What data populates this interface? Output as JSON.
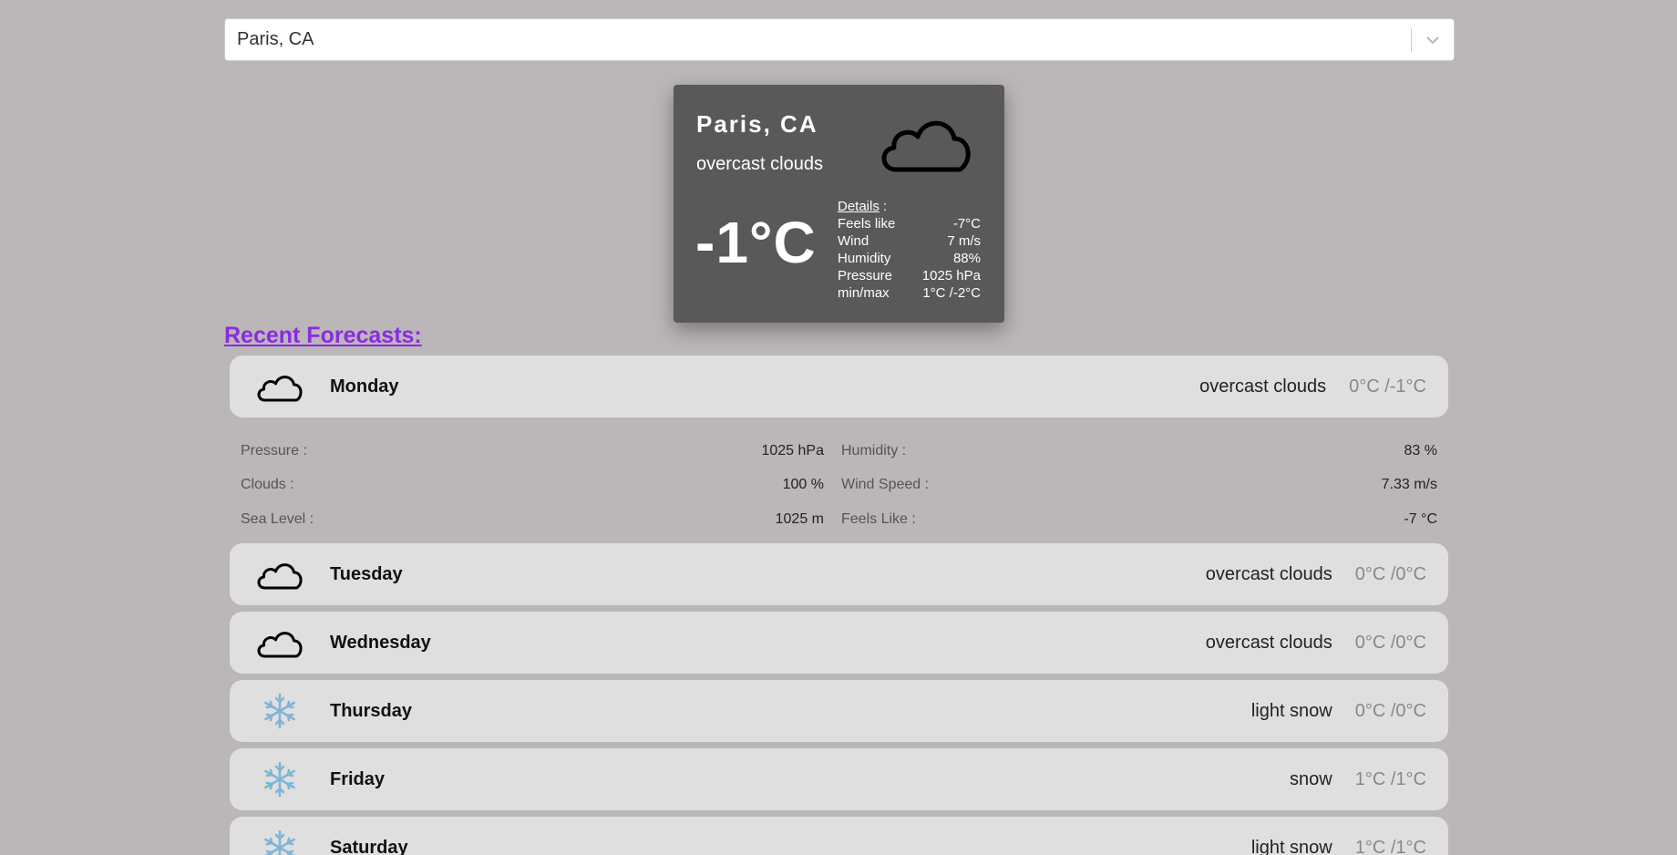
{
  "search": {
    "value": "Paris, CA"
  },
  "current": {
    "city": "Paris, CA",
    "description": "overcast clouds",
    "temperature": "-1°C",
    "icon": "cloud-icon",
    "details": {
      "title": "Details",
      "suffix": " :",
      "rows": [
        {
          "label": "Feels like",
          "value": "-7°C"
        },
        {
          "label": "Wind",
          "value": "7 m/s"
        },
        {
          "label": "Humidity",
          "value": "88%"
        },
        {
          "label": "Pressure",
          "value": "1025 hPa"
        },
        {
          "label": "min/max",
          "value": "1°C /-2°C"
        }
      ]
    }
  },
  "recent_title": "Recent Forecasts:",
  "forecast": [
    {
      "day": "Monday",
      "description": "overcast clouds",
      "temp": "0°C /-1°C",
      "icon": "cloud-icon"
    },
    {
      "day": "Tuesday",
      "description": "overcast clouds",
      "temp": "0°C /0°C",
      "icon": "cloud-icon"
    },
    {
      "day": "Wednesday",
      "description": "overcast clouds",
      "temp": "0°C /0°C",
      "icon": "cloud-icon"
    },
    {
      "day": "Thursday",
      "description": "light snow",
      "temp": "0°C /0°C",
      "icon": "snowflake-icon"
    },
    {
      "day": "Friday",
      "description": "snow",
      "temp": "1°C /1°C",
      "icon": "snowflake-icon"
    },
    {
      "day": "Saturday",
      "description": "light snow",
      "temp": "1°C /1°C",
      "icon": "snowflake-icon"
    }
  ],
  "monday_details": {
    "left": [
      {
        "label": "Pressure :",
        "value": "1025 hPa"
      },
      {
        "label": "Clouds :",
        "value": "100 %"
      },
      {
        "label": "Sea Level :",
        "value": "1025 m"
      }
    ],
    "right": [
      {
        "label": "Humidity :",
        "value": "83 %"
      },
      {
        "label": "Wind Speed :",
        "value": "7.33 m/s"
      },
      {
        "label": "Feels Like :",
        "value": "-7 °C"
      }
    ]
  },
  "colors": {
    "background": "#bbb6b7",
    "card": "#595959",
    "row": "#e0dfe0",
    "accent": "#8a2be2",
    "snow": "#7fb4d6"
  }
}
